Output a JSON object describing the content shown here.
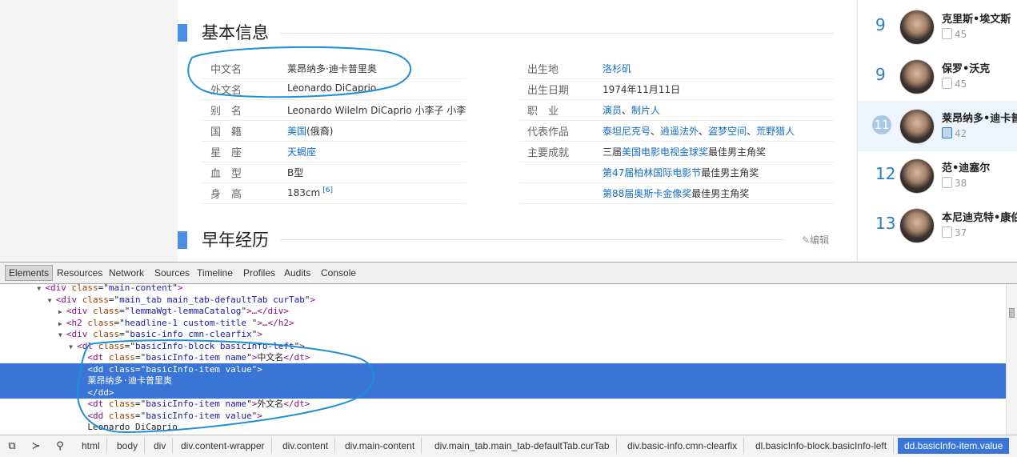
{
  "sections": {
    "basic_info_title": "基本信息",
    "early_life_title": "早年经历",
    "edit_label": "编辑"
  },
  "basic_info_left": [
    {
      "label": "中文名",
      "value": "莱昂纳多·迪卡普里奥"
    },
    {
      "label": "外文名",
      "value": "Leonardo DiCaprio"
    },
    {
      "label": "别　名",
      "value": "Leonardo Wilelm DiCaprio 小李子 小李"
    },
    {
      "label": "国　籍",
      "value_link": "美国",
      "value_rest": "(俄裔)"
    },
    {
      "label": "星　座",
      "value_link": "天蝎座",
      "value_rest": ""
    },
    {
      "label": "血　型",
      "value": "B型"
    },
    {
      "label": "身　高",
      "value": "183cm",
      "ref": "[6]"
    }
  ],
  "basic_info_right": {
    "birthplace": {
      "label": "出生地",
      "value": "洛杉矶"
    },
    "birthdate": {
      "label": "出生日期",
      "value": "1974年11月11日"
    },
    "occupation": {
      "label": "职　业",
      "links": [
        "演员",
        "制片人"
      ],
      "sep": "、"
    },
    "works": {
      "label": "代表作品",
      "links": [
        "泰坦尼克号",
        "逍遥法外",
        "盗梦空间",
        "荒野猎人"
      ],
      "sep": "、"
    },
    "achievements": {
      "label": "主要成就",
      "line1_prefix": "三届",
      "line1_link": "美国电影电视金球奖",
      "line1_suffix": "最佳男主角奖",
      "line2_link": "第47届柏林国际电影节",
      "line2_suffix": "最佳男主角奖",
      "line3_link": "第88届奥斯卡金像奖",
      "line3_suffix": "最佳男主角奖"
    }
  },
  "ranking": [
    {
      "rank": "9",
      "name": "克里斯•埃文斯",
      "likes": "45",
      "active": false
    },
    {
      "rank": "9",
      "name": "保罗•沃克",
      "likes": "45",
      "active": false
    },
    {
      "rank": "11",
      "name": "莱昂纳多•迪卡普",
      "likes": "42",
      "active": true
    },
    {
      "rank": "12",
      "name": "范•迪塞尔",
      "likes": "38",
      "active": false
    },
    {
      "rank": "13",
      "name": "本尼迪克特•康伯",
      "likes": "37",
      "active": false
    }
  ],
  "devtools": {
    "tabs": [
      "Elements",
      "Resources",
      "Network",
      "Sources",
      "Timeline",
      "Profiles",
      "Audits",
      "Console"
    ],
    "active_tab": "Elements",
    "dom_lines": [
      {
        "indent": 8,
        "tri": "▼",
        "tag_open": "<div",
        "attrs": [
          [
            "class",
            "main-content"
          ]
        ],
        "tag_close": ">",
        "text": ""
      },
      {
        "indent": 10,
        "tri": "▼",
        "tag_open": "<div",
        "attrs": [
          [
            "class",
            "main_tab main_tab-defaultTab curTab"
          ]
        ],
        "tag_close": ">",
        "text": ""
      },
      {
        "indent": 12,
        "tri": "▶",
        "tag_open": "<div",
        "attrs": [
          [
            "class",
            "lemmaWgt-lemmaCatalog"
          ]
        ],
        "tag_close": ">…</div>",
        "text": ""
      },
      {
        "indent": 12,
        "tri": "▶",
        "tag_open": "<h2",
        "attrs": [
          [
            "class",
            "headline-1 custom-title "
          ]
        ],
        "tag_close": ">…</h2>",
        "text": ""
      },
      {
        "indent": 12,
        "tri": "▼",
        "tag_open": "<div",
        "attrs": [
          [
            "class",
            "basic-info cmn-clearfix"
          ]
        ],
        "tag_close": ">",
        "text": ""
      },
      {
        "indent": 14,
        "tri": "▼",
        "tag_open": "<dl",
        "attrs": [
          [
            "class",
            "basicInfo-block basicInfo-left"
          ]
        ],
        "tag_close": ">",
        "text": ""
      },
      {
        "indent": 16,
        "tri": "",
        "tag_open": "<dt",
        "attrs": [
          [
            "class",
            "basicInfo-item name"
          ]
        ],
        "tag_close": ">",
        "text": "中文名",
        "end_tag": "</dt>"
      },
      {
        "indent": 16,
        "tri": "",
        "tag_open": "<dd",
        "attrs": [
          [
            "class",
            "basicInfo-item value"
          ]
        ],
        "tag_close": ">",
        "text": "",
        "selected": true
      },
      {
        "indent": 16,
        "tri": "",
        "plain": "莱昂纳多·迪卡普里奥",
        "selected": true
      },
      {
        "indent": 16,
        "tri": "",
        "tag_open": "</dd>",
        "attrs": [],
        "tag_close": "",
        "text": "",
        "selected": true
      },
      {
        "indent": 16,
        "tri": "",
        "tag_open": "<dt",
        "attrs": [
          [
            "class",
            "basicInfo-item name"
          ]
        ],
        "tag_close": ">",
        "text": "外文名",
        "end_tag": "</dt>"
      },
      {
        "indent": 16,
        "tri": "",
        "tag_open": "<dd",
        "attrs": [
          [
            "class",
            "basicInfo-item value"
          ]
        ],
        "tag_close": ">",
        "text": ""
      },
      {
        "indent": 16,
        "tri": "",
        "plain": "Leonardo DiCaprio"
      }
    ],
    "breadcrumbs": [
      "html",
      "body",
      "div",
      "div.content-wrapper",
      "div.content",
      "div.main-content",
      "div.main_tab.main_tab-defaultTab.curTab",
      "div.basic-info.cmn-clearfix",
      "dl.basicInfo-block.basicInfo-left",
      "dd.basicInfo-item.value"
    ],
    "status_icons": [
      "dock-icon",
      "console-drawer-icon",
      "search-icon"
    ]
  },
  "colors": {
    "accent": "#4a90e2",
    "link": "#136ec2",
    "selection": "#3875d7",
    "annotation": "#1c8fd6"
  }
}
